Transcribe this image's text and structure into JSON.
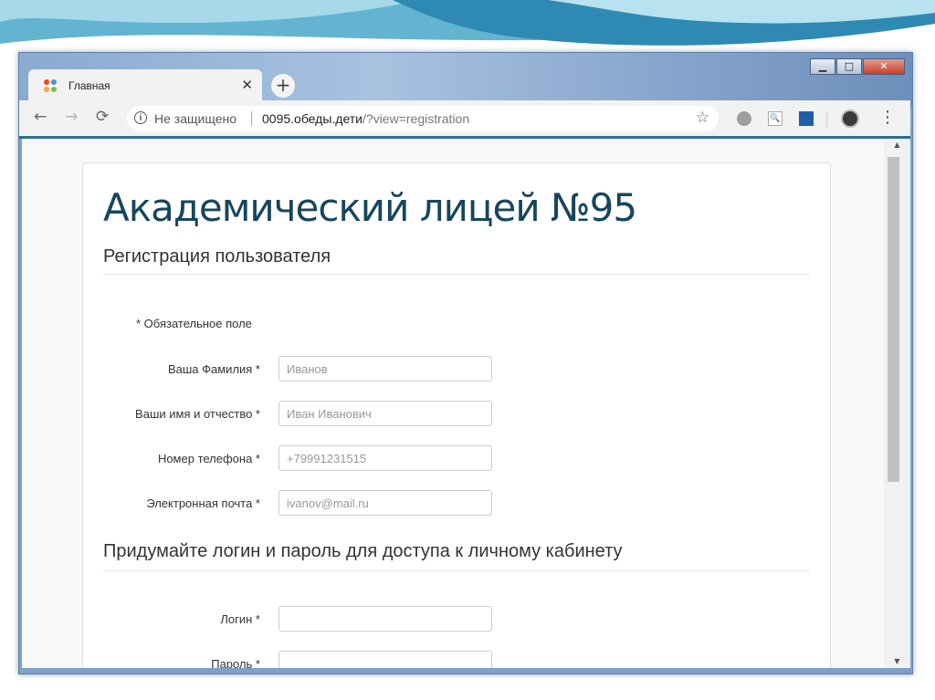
{
  "browser": {
    "tab": {
      "title": "Главная",
      "close_glyph": "✕"
    },
    "new_tab_glyph": "+",
    "nav": {
      "back_glyph": "←",
      "forward_glyph": "→",
      "reload_glyph": "⟳"
    },
    "omnibox": {
      "info_glyph": "i",
      "security_label": "Не защищено",
      "url_domain": "0095.обеды.дети",
      "url_path": "/?view=registration"
    },
    "bookmark_glyph": "☆",
    "menu_glyph": "⋮",
    "window_controls": {
      "minimize": "▁",
      "maximize": "□",
      "close": "✕"
    },
    "accent_color": "#2c6f8e"
  },
  "page": {
    "site_title": "Академический лицей №95",
    "registration_title": "Регистрация пользователя",
    "required_note": "* Обязательное поле",
    "fields": [
      {
        "label": "Ваша Фамилия *",
        "placeholder": "Иванов"
      },
      {
        "label": "Ваши имя и отчество *",
        "placeholder": "Иван Иванович"
      },
      {
        "label": "Номер телефона *",
        "placeholder": "+79991231515"
      },
      {
        "label": "Электронная почта *",
        "placeholder": "ivanov@mail.ru"
      }
    ],
    "credentials_title": "Придумайте логин и пароль для доступа к личному кабинету",
    "login_label": "Логин *",
    "password_label": "Пароль *",
    "title_color": "#17465c"
  }
}
